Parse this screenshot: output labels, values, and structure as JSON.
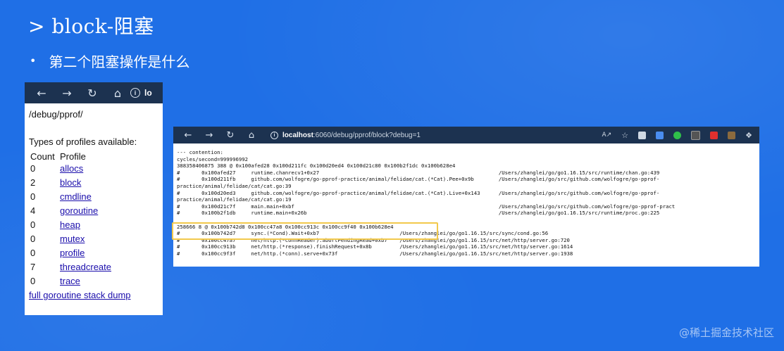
{
  "slide": {
    "title": "> block-阻塞",
    "bullet_marker": "•",
    "bullet_text": "第二个阻塞操作是什么"
  },
  "left_browser": {
    "toolbar": {
      "back_icon": "back-arrow-icon",
      "forward_icon": "forward-arrow-icon",
      "reload_icon": "reload-icon",
      "home_icon": "home-icon",
      "info_icon": "info-icon",
      "url_fragment": "lo"
    },
    "path": "/debug/pprof/",
    "types_heading": "Types of profiles available:",
    "table_header": {
      "count": "Count",
      "profile": "Profile"
    },
    "profiles": [
      {
        "count": "0",
        "name": "allocs"
      },
      {
        "count": "2",
        "name": "block"
      },
      {
        "count": "0",
        "name": "cmdline"
      },
      {
        "count": "4",
        "name": "goroutine"
      },
      {
        "count": "0",
        "name": "heap"
      },
      {
        "count": "0",
        "name": "mutex"
      },
      {
        "count": "0",
        "name": "profile"
      },
      {
        "count": "7",
        "name": "threadcreate"
      },
      {
        "count": "0",
        "name": "trace"
      }
    ],
    "full_dump_link": "full goroutine stack dump"
  },
  "right_browser": {
    "url_host": "localhost",
    "url_rest": ":6060/debug/pprof/block?debug=1",
    "dump_lines": [
      "--- contention:",
      "cycles/second=999996992",
      "388358406875 388 @ 0x100afed28 0x100d211fc 0x100d20ed4 0x100d21c80 0x100b2f1dc 0x100b628e4",
      "#       0x100afed27     runtime.chanrecv1+0x27                                                          /Users/zhanglei/go/go1.16.15/src/runtime/chan.go:439",
      "#       0x100d211fb     github.com/wolfogre/go-pprof-practice/animal/felidae/cat.(*Cat).Pee+0x9b        /Users/zhanglei/go/src/github.com/wolfogre/go-pprof-",
      "practice/animal/felidae/cat/cat.go:39",
      "#       0x100d20ed3     github.com/wolfogre/go-pprof-practice/animal/felidae/cat.(*Cat).Live+0x143      /Users/zhanglei/go/src/github.com/wolfogre/go-pprof-",
      "practice/animal/felidae/cat/cat.go:19",
      "#       0x100d21c7f     main.main+0xbf                                                                  /Users/zhanglei/go/src/github.com/wolfogre/go-pprof-pract",
      "#       0x100b2f1db     runtime.main+0x26b                                                              /Users/zhanglei/go/go1.16.15/src/runtime/proc.go:225",
      "",
      "258666 8 @ 0x100b742d8 0x100cc47a8 0x100cc913c 0x100cc9f40 0x100b628e4",
      "#       0x100b742d7     sync.(*Cond).Wait+0xb7                          /Users/zhanglei/go/go1.16.15/src/sync/cond.go:56",
      "#       0x100cc47a7     net/http.(*connReader).abortPendingRead+0xb7    /Users/zhanglei/go/go1.16.15/src/net/http/server.go:720",
      "#       0x100cc913b     net/http.(*response).finishRequest+0x8b         /Users/zhanglei/go/go1.16.15/src/net/http/server.go:1614",
      "#       0x100cc9f3f     net/http.(*conn).serve+0x73f                    /Users/zhanglei/go/go1.16.15/src/net/http/server.go:1938"
    ]
  },
  "watermark": "@稀土掘金技术社区",
  "colors": {
    "slide_bg": "#1f6fe6",
    "toolbar_bg": "#1c3250",
    "link": "#1a0dab",
    "highlight": "#f2c94c"
  }
}
